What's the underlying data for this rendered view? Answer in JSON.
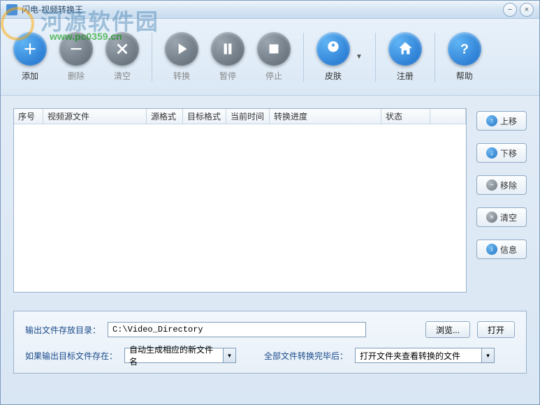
{
  "window": {
    "title": "闪电-视频转换王"
  },
  "watermark": {
    "text": "河源软件园",
    "url": "www.pc0359.cn"
  },
  "toolbar": {
    "add": "添加",
    "delete": "删除",
    "clear": "清空",
    "convert": "转换",
    "pause": "暂停",
    "stop": "停止",
    "skin": "皮肤",
    "register": "注册",
    "help": "帮助"
  },
  "table": {
    "headers": [
      "序号",
      "视频源文件",
      "源格式",
      "目标格式",
      "当前时间",
      "转换进度",
      "状态"
    ]
  },
  "side": {
    "moveUp": "上移",
    "moveDown": "下移",
    "remove": "移除",
    "clear": "清空",
    "info": "信息"
  },
  "bottom": {
    "outputDirLabel": "输出文件存放目录：",
    "outputDirValue": "C:\\Video_Directory",
    "browse": "浏览...",
    "open": "打开",
    "ifExistsLabel": "如果输出目标文件存在：",
    "ifExistsValue": "自动生成相应的新文件名",
    "afterAllLabel": "全部文件转换完毕后：",
    "afterAllValue": "打开文件夹查看转换的文件"
  }
}
